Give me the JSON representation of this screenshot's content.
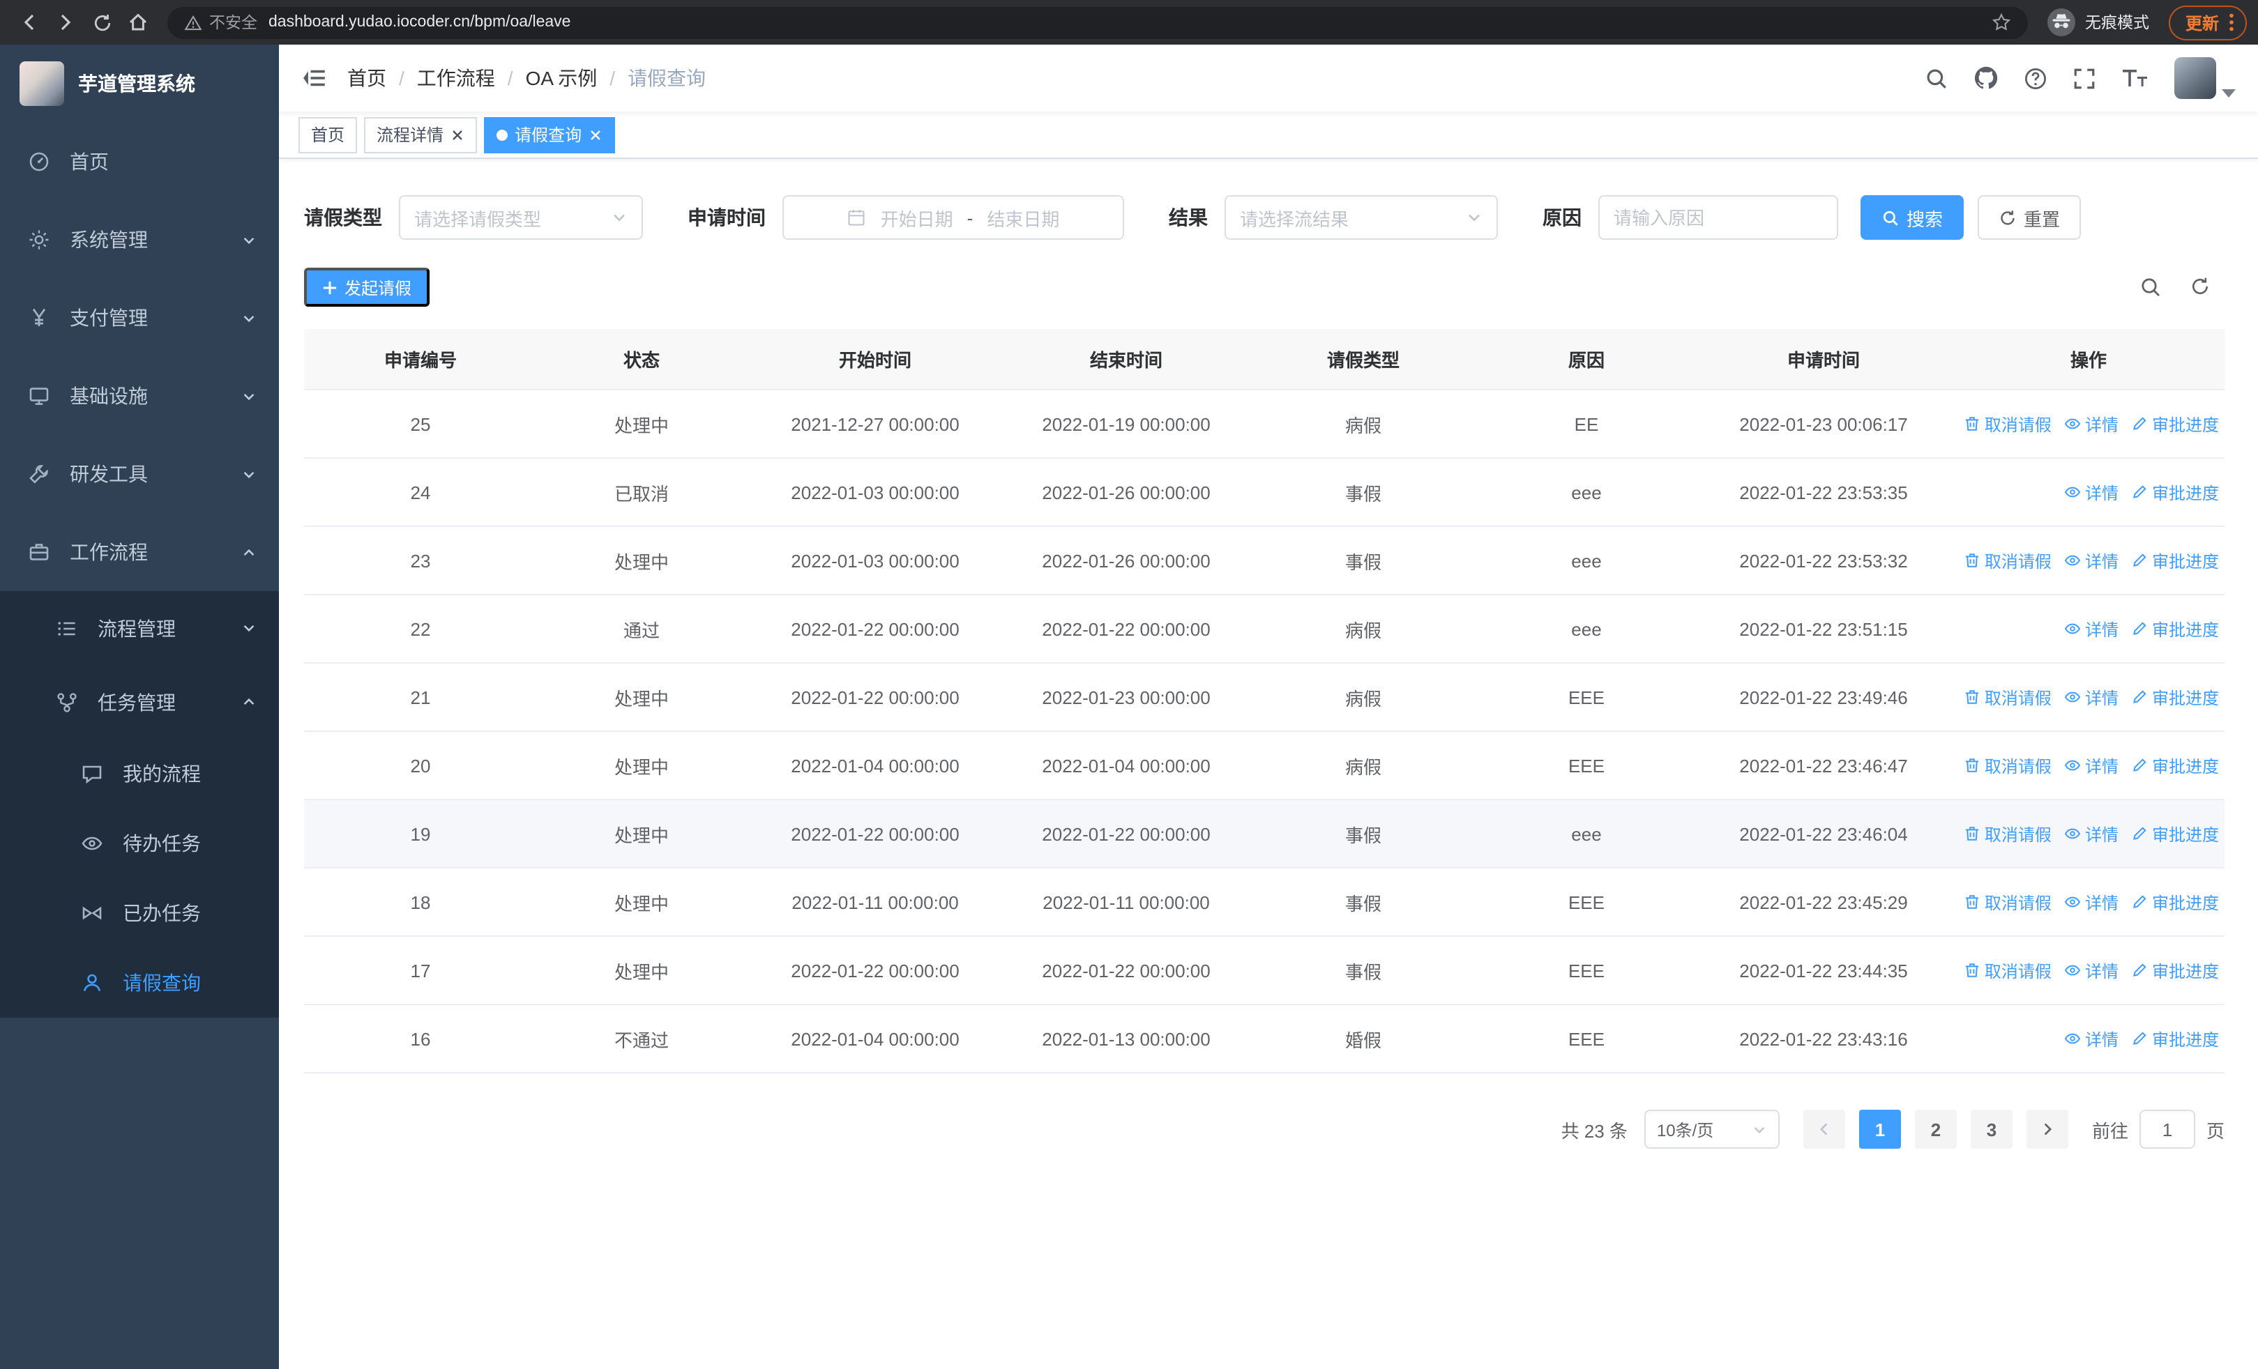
{
  "browser": {
    "security_label": "不安全",
    "url": "dashboard.yudao.iocoder.cn/bpm/oa/leave",
    "incognito_label": "无痕模式",
    "update_label": "更新"
  },
  "app": {
    "title": "芋道管理系统"
  },
  "sidebar": {
    "items": [
      "首页",
      "系统管理",
      "支付管理",
      "基础设施",
      "研发工具",
      "工作流程"
    ],
    "sub_items": [
      "流程管理",
      "任务管理"
    ],
    "task_items": [
      "我的流程",
      "待办任务",
      "已办任务",
      "请假查询"
    ]
  },
  "breadcrumb": [
    "首页",
    "工作流程",
    "OA 示例",
    "请假查询"
  ],
  "tabs": [
    {
      "label": "首页"
    },
    {
      "label": "流程详情"
    },
    {
      "label": "请假查询"
    }
  ],
  "filters": {
    "leave_type_label": "请假类型",
    "leave_type_placeholder": "请选择请假类型",
    "apply_time_label": "申请时间",
    "start_date_placeholder": "开始日期",
    "date_separator": "-",
    "end_date_placeholder": "结束日期",
    "result_label": "结果",
    "result_placeholder": "请选择流结果",
    "reason_label": "原因",
    "reason_placeholder": "请输入原因",
    "search_button": "搜索",
    "reset_button": "重置"
  },
  "toolbar": {
    "create_button": "发起请假"
  },
  "table": {
    "columns": [
      "申请编号",
      "状态",
      "开始时间",
      "结束时间",
      "请假类型",
      "原因",
      "申请时间",
      "操作"
    ],
    "action_labels": {
      "cancel": "取消请假",
      "detail": "详情",
      "progress": "审批进度"
    },
    "rows": [
      {
        "id": "25",
        "status": "处理中",
        "start": "2021-12-27 00:00:00",
        "end": "2022-01-19 00:00:00",
        "type": "病假",
        "reason": "EE",
        "applied": "2022-01-23 00:06:17",
        "actions": [
          "cancel",
          "detail",
          "progress"
        ],
        "highlight": false
      },
      {
        "id": "24",
        "status": "已取消",
        "start": "2022-01-03 00:00:00",
        "end": "2022-01-26 00:00:00",
        "type": "事假",
        "reason": "eee",
        "applied": "2022-01-22 23:53:35",
        "actions": [
          "detail",
          "progress"
        ],
        "highlight": false
      },
      {
        "id": "23",
        "status": "处理中",
        "start": "2022-01-03 00:00:00",
        "end": "2022-01-26 00:00:00",
        "type": "事假",
        "reason": "eee",
        "applied": "2022-01-22 23:53:32",
        "actions": [
          "cancel",
          "detail",
          "progress"
        ],
        "highlight": false
      },
      {
        "id": "22",
        "status": "通过",
        "start": "2022-01-22 00:00:00",
        "end": "2022-01-22 00:00:00",
        "type": "病假",
        "reason": "eee",
        "applied": "2022-01-22 23:51:15",
        "actions": [
          "detail",
          "progress"
        ],
        "highlight": false
      },
      {
        "id": "21",
        "status": "处理中",
        "start": "2022-01-22 00:00:00",
        "end": "2022-01-23 00:00:00",
        "type": "病假",
        "reason": "EEE",
        "applied": "2022-01-22 23:49:46",
        "actions": [
          "cancel",
          "detail",
          "progress"
        ],
        "highlight": false
      },
      {
        "id": "20",
        "status": "处理中",
        "start": "2022-01-04 00:00:00",
        "end": "2022-01-04 00:00:00",
        "type": "病假",
        "reason": "EEE",
        "applied": "2022-01-22 23:46:47",
        "actions": [
          "cancel",
          "detail",
          "progress"
        ],
        "highlight": false
      },
      {
        "id": "19",
        "status": "处理中",
        "start": "2022-01-22 00:00:00",
        "end": "2022-01-22 00:00:00",
        "type": "事假",
        "reason": "eee",
        "applied": "2022-01-22 23:46:04",
        "actions": [
          "cancel",
          "detail",
          "progress"
        ],
        "highlight": true
      },
      {
        "id": "18",
        "status": "处理中",
        "start": "2022-01-11 00:00:00",
        "end": "2022-01-11 00:00:00",
        "type": "事假",
        "reason": "EEE",
        "applied": "2022-01-22 23:45:29",
        "actions": [
          "cancel",
          "detail",
          "progress"
        ],
        "highlight": false
      },
      {
        "id": "17",
        "status": "处理中",
        "start": "2022-01-22 00:00:00",
        "end": "2022-01-22 00:00:00",
        "type": "事假",
        "reason": "EEE",
        "applied": "2022-01-22 23:44:35",
        "actions": [
          "cancel",
          "detail",
          "progress"
        ],
        "highlight": false
      },
      {
        "id": "16",
        "status": "不通过",
        "start": "2022-01-04 00:00:00",
        "end": "2022-01-13 00:00:00",
        "type": "婚假",
        "reason": "EEE",
        "applied": "2022-01-22 23:43:16",
        "actions": [
          "detail",
          "progress"
        ],
        "highlight": false
      }
    ]
  },
  "pagination": {
    "total_text": "共 23 条",
    "page_size": "10条/页",
    "pages": [
      "1",
      "2",
      "3"
    ],
    "active_page": "1",
    "goto_label": "前往",
    "goto_value": "1",
    "page_unit": "页"
  },
  "colors": {
    "primary": "#409eff",
    "sidebar_bg": "#304156",
    "sidebar_sub_bg": "#1f2d3d"
  }
}
